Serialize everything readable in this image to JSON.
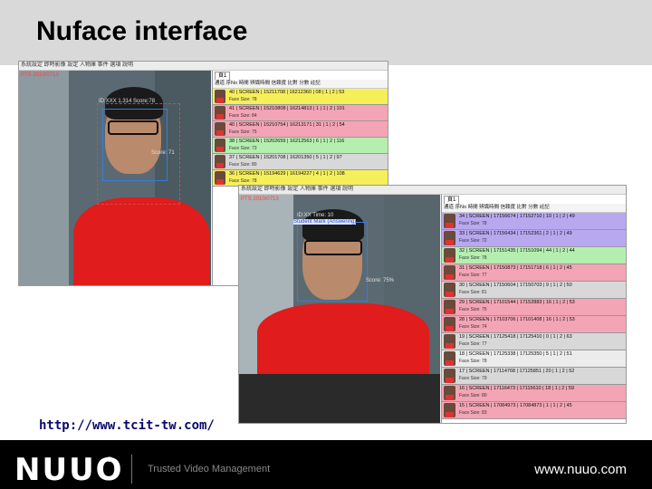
{
  "title": "Nuface interface",
  "link": "http://www.tcit-tw.com/",
  "footer": {
    "logo": "NUUO",
    "reg": "®",
    "tagline": "Trusted Video Management",
    "url": "www.nuuo.com"
  },
  "screenshot1": {
    "menu": "系統設定  即時影像  設定  人物庫  事件  選項  說明",
    "overlay_top": "PTS 2010/0713",
    "overlay_face": "ID:XXX 1.314 Score:78",
    "overlay_score": "Score: 71",
    "panel_tab": "頁1",
    "panel_header": "通道  序No  時間  辨識時間  信賴度  比對  分數  註記",
    "rows": [
      {
        "text": "40 | SCREEN | 15211708 | 16212360 | 08 | 1 | 2 | 53",
        "sub": "Face Size: 78",
        "color": "#f5ef5a"
      },
      {
        "text": "41 | SCREEN | 15210808 | 16214813 | 1 | 1 | 2 | 101",
        "sub": "Face Size: 84",
        "color": "#f4a5b5"
      },
      {
        "text": "40 | SCREEN | 15210754 | 16213171 | 31 | 1 | 2 | 54",
        "sub": "Face Size: 75",
        "color": "#f4a5b5"
      },
      {
        "text": "38 | SCREEN | 15202659 | 16212563 | 6 | 1 | 2 | 116",
        "sub": "Face Size: 73",
        "color": "#b5efb0"
      },
      {
        "text": "37 | SCREEN | 15201708 | 16201350 | 5 | 1 | 2 | 97",
        "sub": "Face Size: 80",
        "color": "#d8d8d8"
      },
      {
        "text": "36 | SCREEN | 15194629 | 16194227 | 4 | 1 | 2 | 108",
        "sub": "Face Size: 78",
        "color": "#f5ef5a"
      }
    ]
  },
  "screenshot2": {
    "menu": "系統設定  即時影像  設定  人物庫  事件  選項  說明",
    "overlay_top": "PTS 2010/0713",
    "overlay_face": "ID:XX Time: 10",
    "overlay_name": "Student Mark (Answering)",
    "overlay_score": "Score: 75%",
    "panel_tab": "頁1",
    "panel_header": "通道  序No  時間  辨識時間  信賴度  比對  分數  註記",
    "rows": [
      {
        "text": "34 | SCREEN | 17156674 | 17152710 | 10 | 1 | 2 | 49",
        "sub": "Face Size: 78",
        "color": "#b8a8f0"
      },
      {
        "text": "33 | SCREEN | 17156434 | 17152361 | 2 | 1 | 2 | 49",
        "sub": "Face Size: 72",
        "color": "#b8a8f0"
      },
      {
        "text": "32 | SCREEN | 17151435 | 17151094 | 44 | 1 | 2 | 44",
        "sub": "Face Size: 78",
        "color": "#b5efb0"
      },
      {
        "text": "31 | SCREEN | 17150873 | 17151718 | 6 | 1 | 2 | 45",
        "sub": "Face Size: 77",
        "color": "#f4a5b5"
      },
      {
        "text": "30 | SCREEN | 17150604 | 17150703 | 9 | 1 | 2 | 50",
        "sub": "Face Size: 81",
        "color": "#d8d8d8"
      },
      {
        "text": "29 | SCREEN | 17101544 | 17152883 | 16 | 1 | 2 | 53",
        "sub": "Face Size: 75",
        "color": "#f4a5b5"
      },
      {
        "text": "28 | SCREEN | 17103706 | 17101408 | 16 | 1 | 2 | 53",
        "sub": "Face Size: 74",
        "color": "#f4a5b5"
      },
      {
        "text": "19 | SCREEN | 17125418 | 17125410 | 0 | 1 | 2 | 63",
        "sub": "Face Size: 77",
        "color": "#d8d8d8"
      },
      {
        "text": "18 | SCREEN | 17125338 | 17125350 | 5 | 1 | 2 | 51",
        "sub": "Face Size: 78",
        "color": "#ececec"
      },
      {
        "text": "17 | SCREEN | 17114768 | 17125851 | 20 | 1 | 2 | 52",
        "sub": "Face Size: 79",
        "color": "#d8d8d8"
      },
      {
        "text": "16 | SCREEN | 17116473 | 17115610 | 18 | 1 | 2 | 59",
        "sub": "Face Size: 80",
        "color": "#f4a5b5"
      },
      {
        "text": "15 | SCREEN | 17084973 | 17084873 | 1 | 1 | 2 | 45",
        "sub": "Face Size: 83",
        "color": "#f4a5b5"
      }
    ]
  }
}
